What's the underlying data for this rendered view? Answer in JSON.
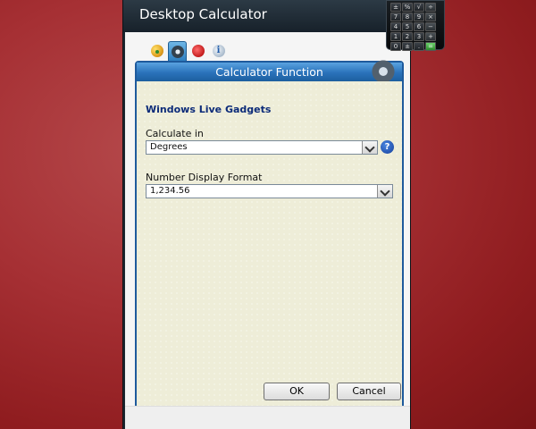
{
  "window": {
    "title": "Desktop Calculator",
    "tabs": [
      {
        "icon": "palette-icon",
        "active": false
      },
      {
        "icon": "gear-icon",
        "active": true
      },
      {
        "icon": "undo-icon",
        "active": false
      },
      {
        "icon": "info-icon",
        "active": false
      }
    ]
  },
  "panel": {
    "title": "Calculator Function",
    "heading": "Windows Live Gadgets",
    "calculate_in": {
      "label": "Calculate in",
      "value": "Degrees",
      "help_glyph": "?"
    },
    "number_display_format": {
      "label": "Number Display Format",
      "value": "1,234.56"
    }
  },
  "buttons": {
    "ok": "OK",
    "cancel": "Cancel"
  },
  "gadget": {
    "keys": [
      "±",
      "%",
      "√",
      "÷",
      "7",
      "8",
      "9",
      "×",
      "4",
      "5",
      "6",
      "−",
      "1",
      "2",
      "3",
      "+",
      "0",
      "±",
      ".",
      "="
    ]
  },
  "colors": {
    "desktop": "#a63034",
    "titlebar": "#1d2730",
    "panel_header": "#2a72ba",
    "panel_body": "#eeedd8",
    "heading_text": "#0b2a78"
  }
}
